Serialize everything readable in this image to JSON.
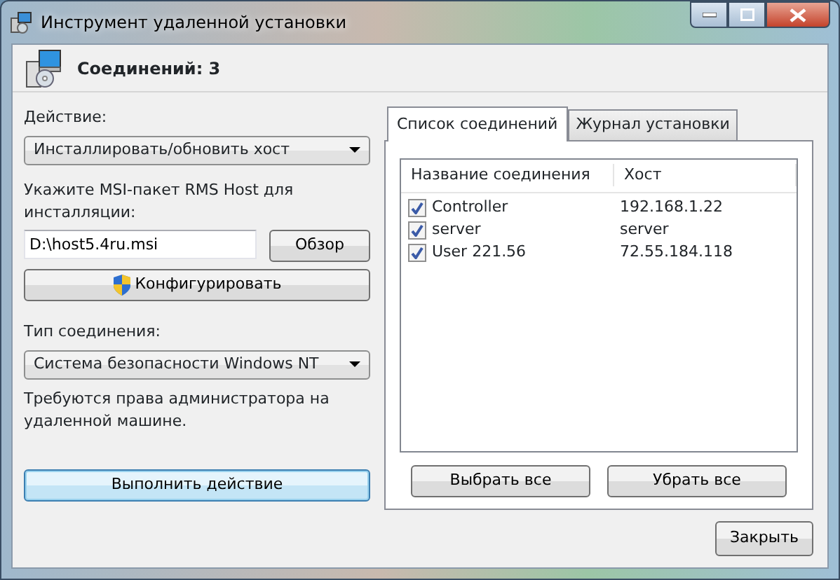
{
  "window": {
    "title": "Инструмент удаленной установки"
  },
  "header": {
    "text": "Соединений: 3"
  },
  "action": {
    "label": "Действие:",
    "value": "Инсталлировать/обновить хост"
  },
  "msi": {
    "label": "Укажите MSI-пакет RMS Host для инсталляции:",
    "value": "D:\\host5.4ru.msi",
    "browse": "Обзор"
  },
  "configure": "Конфигурировать",
  "connection_type": {
    "label": "Тип соединения:",
    "value": "Система безопасности Windows NT"
  },
  "note": "Требуются права администратора на удаленной машине.",
  "run": "Выполнить действие",
  "tabs": [
    {
      "label": "Список соединений",
      "selected": true
    },
    {
      "label": "Журнал установки",
      "selected": false
    }
  ],
  "table": {
    "columns": [
      "Название соединения",
      "Хост"
    ],
    "rows": [
      {
        "name": "Controller",
        "host": "192.168.1.22",
        "checked": true
      },
      {
        "name": "server",
        "host": "server",
        "checked": true
      },
      {
        "name": "User 221.56",
        "host": "72.55.184.118",
        "checked": true
      }
    ]
  },
  "select_all": "Выбрать все",
  "clear_all": "Убрать все",
  "close": "Закрыть"
}
